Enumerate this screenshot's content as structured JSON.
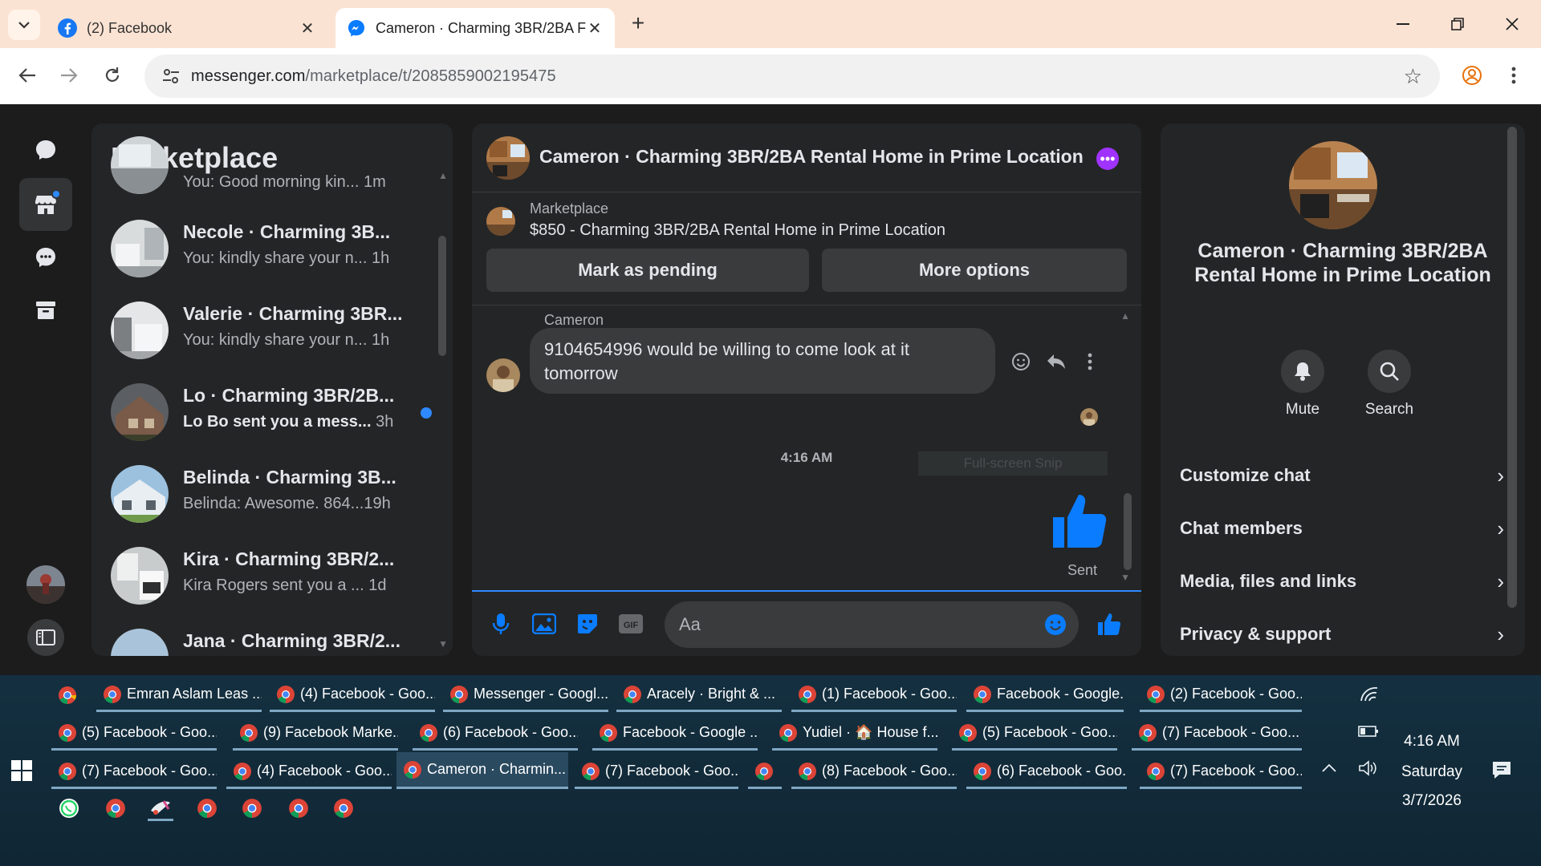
{
  "browser": {
    "tabs": [
      {
        "title": "(2) Facebook",
        "icon": "facebook-icon",
        "active": false
      },
      {
        "title": "Cameron · Charming 3BR/2BA F",
        "icon": "messenger-icon",
        "active": true
      }
    ],
    "url_host": "messenger.com",
    "url_path": "/marketplace/t/2085859002195475"
  },
  "sidebar": {
    "title": "Marketplace",
    "conversations": [
      {
        "name": "",
        "preview": "You: Good morning kin...",
        "time": "1m",
        "unread": false
      },
      {
        "name": "Necole · Charming 3B...",
        "preview": "You: kindly share your n...",
        "time": "1h",
        "unread": false
      },
      {
        "name": "Valerie · Charming 3BR...",
        "preview": "You: kindly share your n...",
        "time": "1h",
        "unread": false
      },
      {
        "name": "Lo · Charming 3BR/2B...",
        "preview": "Lo Bo sent you a mess...",
        "time": "3h",
        "unread": true
      },
      {
        "name": "Belinda · Charming 3B...",
        "preview": "Belinda: Awesome. 864...",
        "time": "19h",
        "unread": false
      },
      {
        "name": "Kira · Charming 3BR/2...",
        "preview": "Kira Rogers sent you a ...",
        "time": "1d",
        "unread": false
      },
      {
        "name": "Jana · Charming 3BR/2...",
        "preview": "",
        "time": "",
        "unread": false
      }
    ]
  },
  "chat": {
    "title": "Cameron · Charming 3BR/2BA Rental Home in Prime Location",
    "listing_source": "Marketplace",
    "listing_title": "$850 - Charming 3BR/2BA Rental Home in Prime Location",
    "mark_pending_label": "Mark as pending",
    "more_options_label": "More options",
    "sender_name": "Cameron",
    "message_line1": "9104654996 would be willing to come look at it",
    "message_line2": "tomorrow",
    "timestamp": "4:16 AM",
    "snip_tooltip": "Full-screen Snip",
    "sent_label": "Sent",
    "composer_placeholder": "Aa",
    "accent_color": "#a033ff"
  },
  "info": {
    "title": "Cameron · Charming 3BR/2BA Rental Home in Prime Location",
    "mute_label": "Mute",
    "search_label": "Search",
    "rows": [
      "Customize chat",
      "Chat members",
      "Media, files and links",
      "Privacy & support"
    ]
  },
  "taskbar": {
    "row1": [
      "",
      "Emran Aslam Leas ...",
      "(4) Facebook - Goo...",
      "Messenger - Googl...",
      "Aracely · Bright & ...",
      "(1) Facebook - Goo...",
      "Facebook - Google...",
      "(2) Facebook - Goo..."
    ],
    "row2": [
      "(5) Facebook - Goo...",
      "(9) Facebook Marke...",
      "(6) Facebook - Goo...",
      "Facebook - Google ...",
      "Yudiel · 🏠 House f...",
      "(5) Facebook - Goo...",
      "(7) Facebook - Goo..."
    ],
    "row3": [
      "(7) Facebook - Goo...",
      "(4) Facebook - Goo...",
      "Cameron · Charmin...",
      "(7) Facebook - Goo...",
      "",
      "(8) Facebook - Goo...",
      "(6) Facebook - Goo...",
      "(7) Facebook - Goo..."
    ],
    "time": "4:16 AM",
    "day": "Saturday",
    "date": "3/7/2026"
  }
}
